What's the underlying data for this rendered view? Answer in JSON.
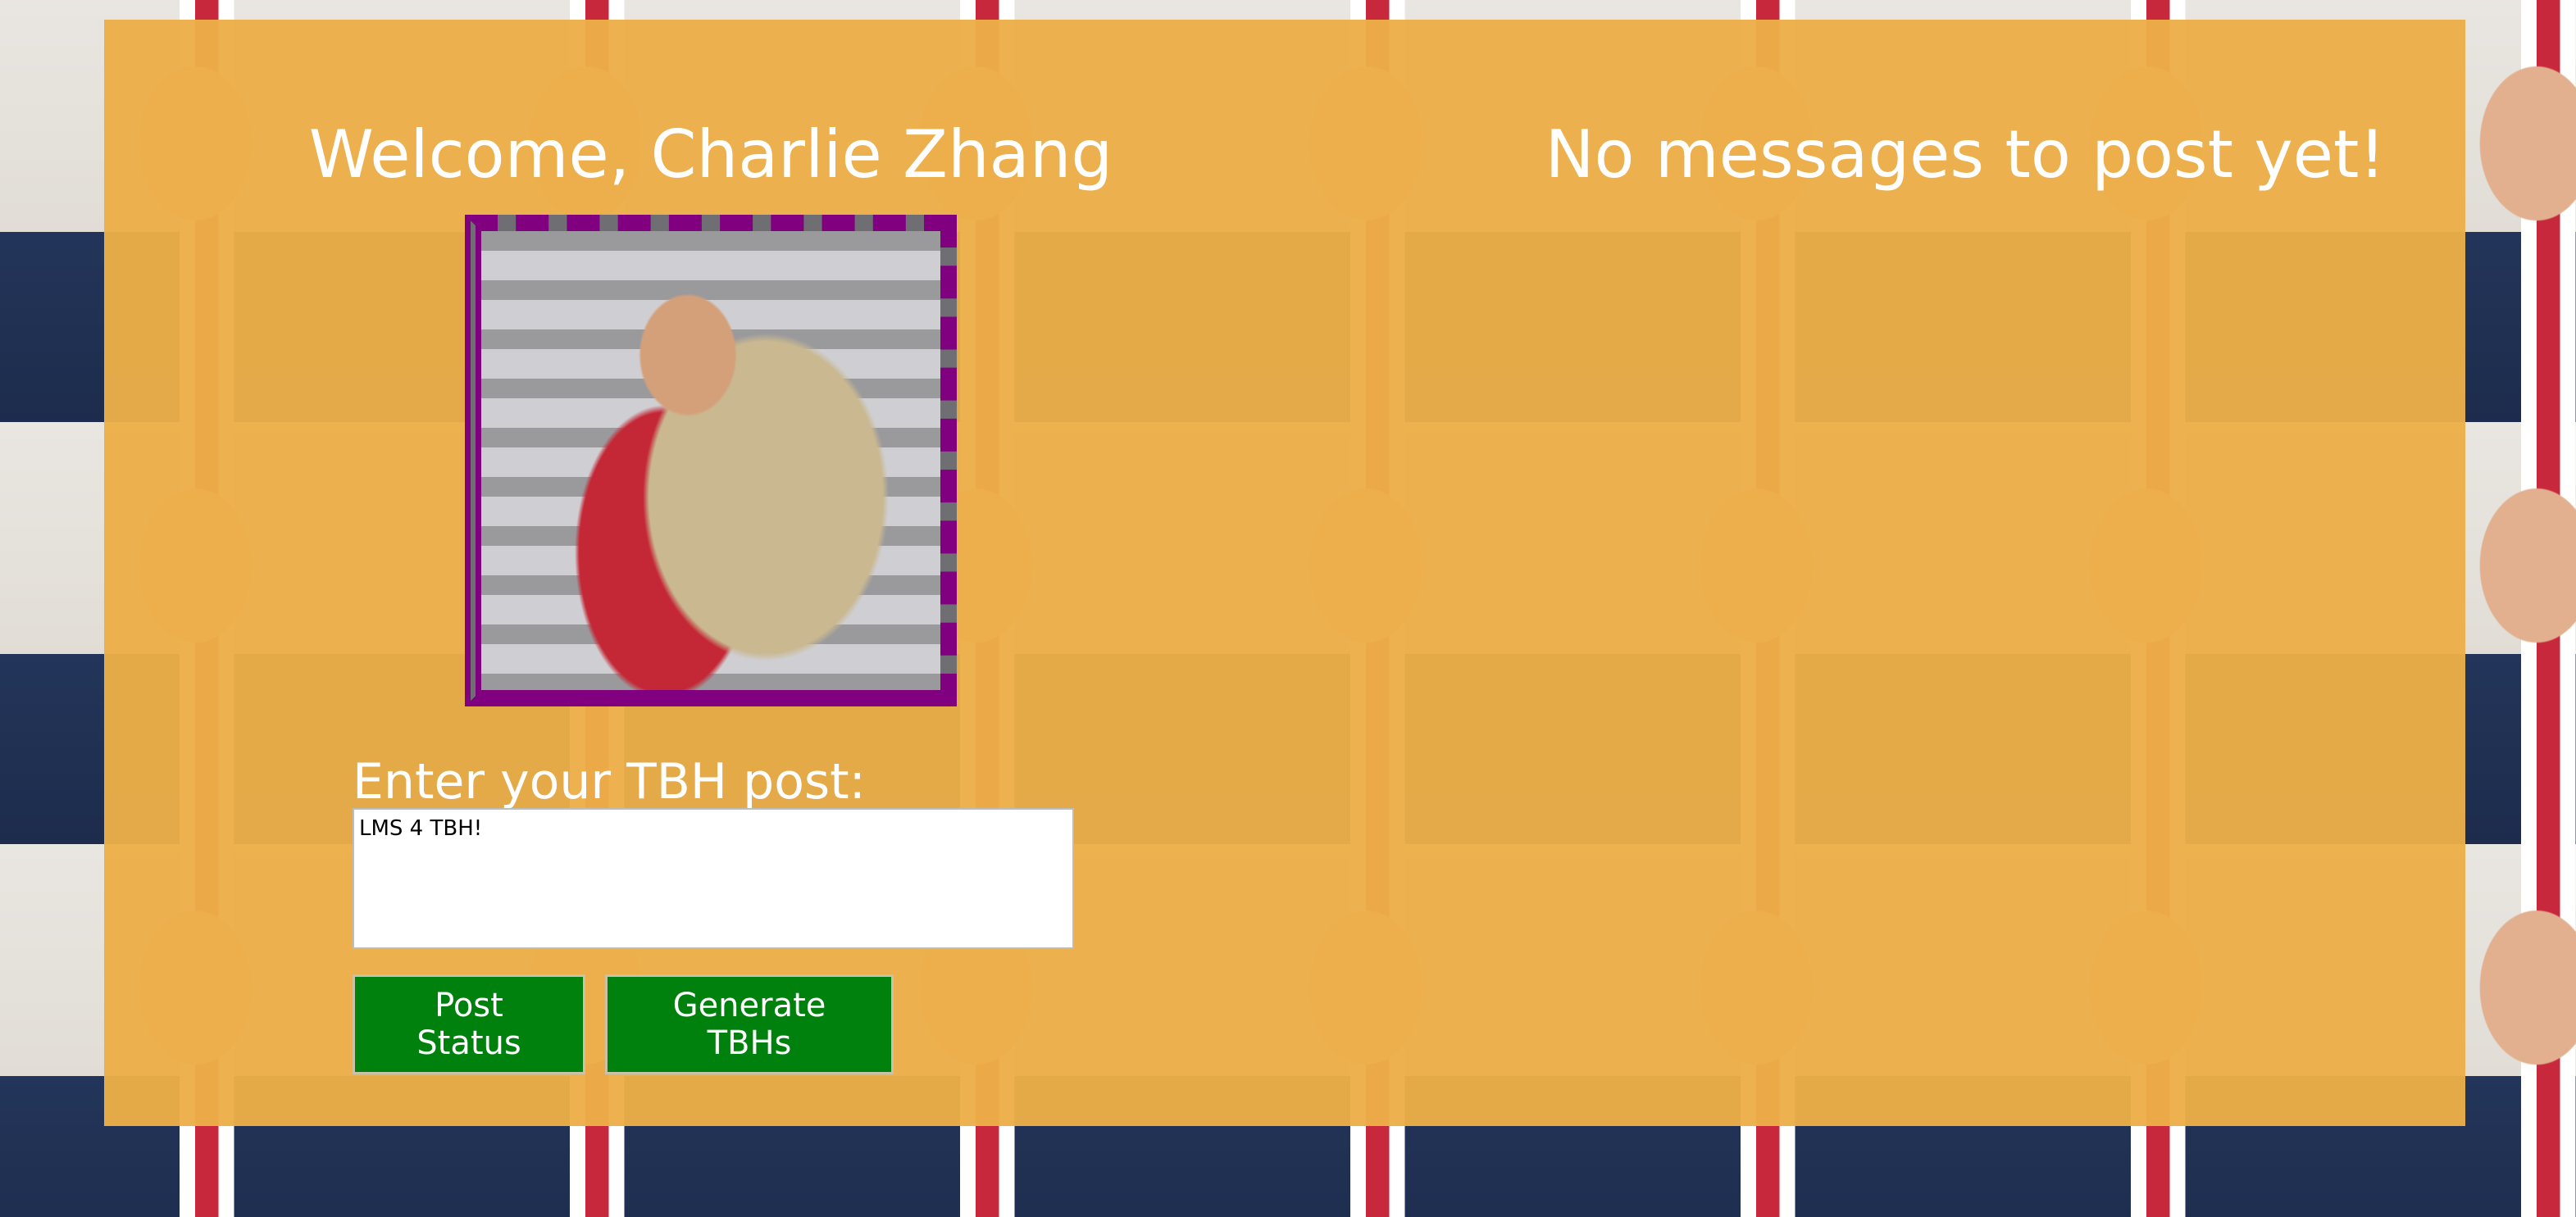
{
  "welcome": {
    "heading": "Welcome, Charlie Zhang",
    "photo_alt": "profile photo"
  },
  "messages": {
    "heading": "No messages to post yet!"
  },
  "composer": {
    "label": "Enter your TBH post:",
    "value": "LMS 4 TBH!",
    "post_button": "Post Status",
    "generate_button": "Generate TBHs"
  },
  "colors": {
    "panel": "#ecaf48",
    "frame_border": "#800080",
    "button_bg": "#00800d",
    "heading_text": "#ffffff"
  }
}
